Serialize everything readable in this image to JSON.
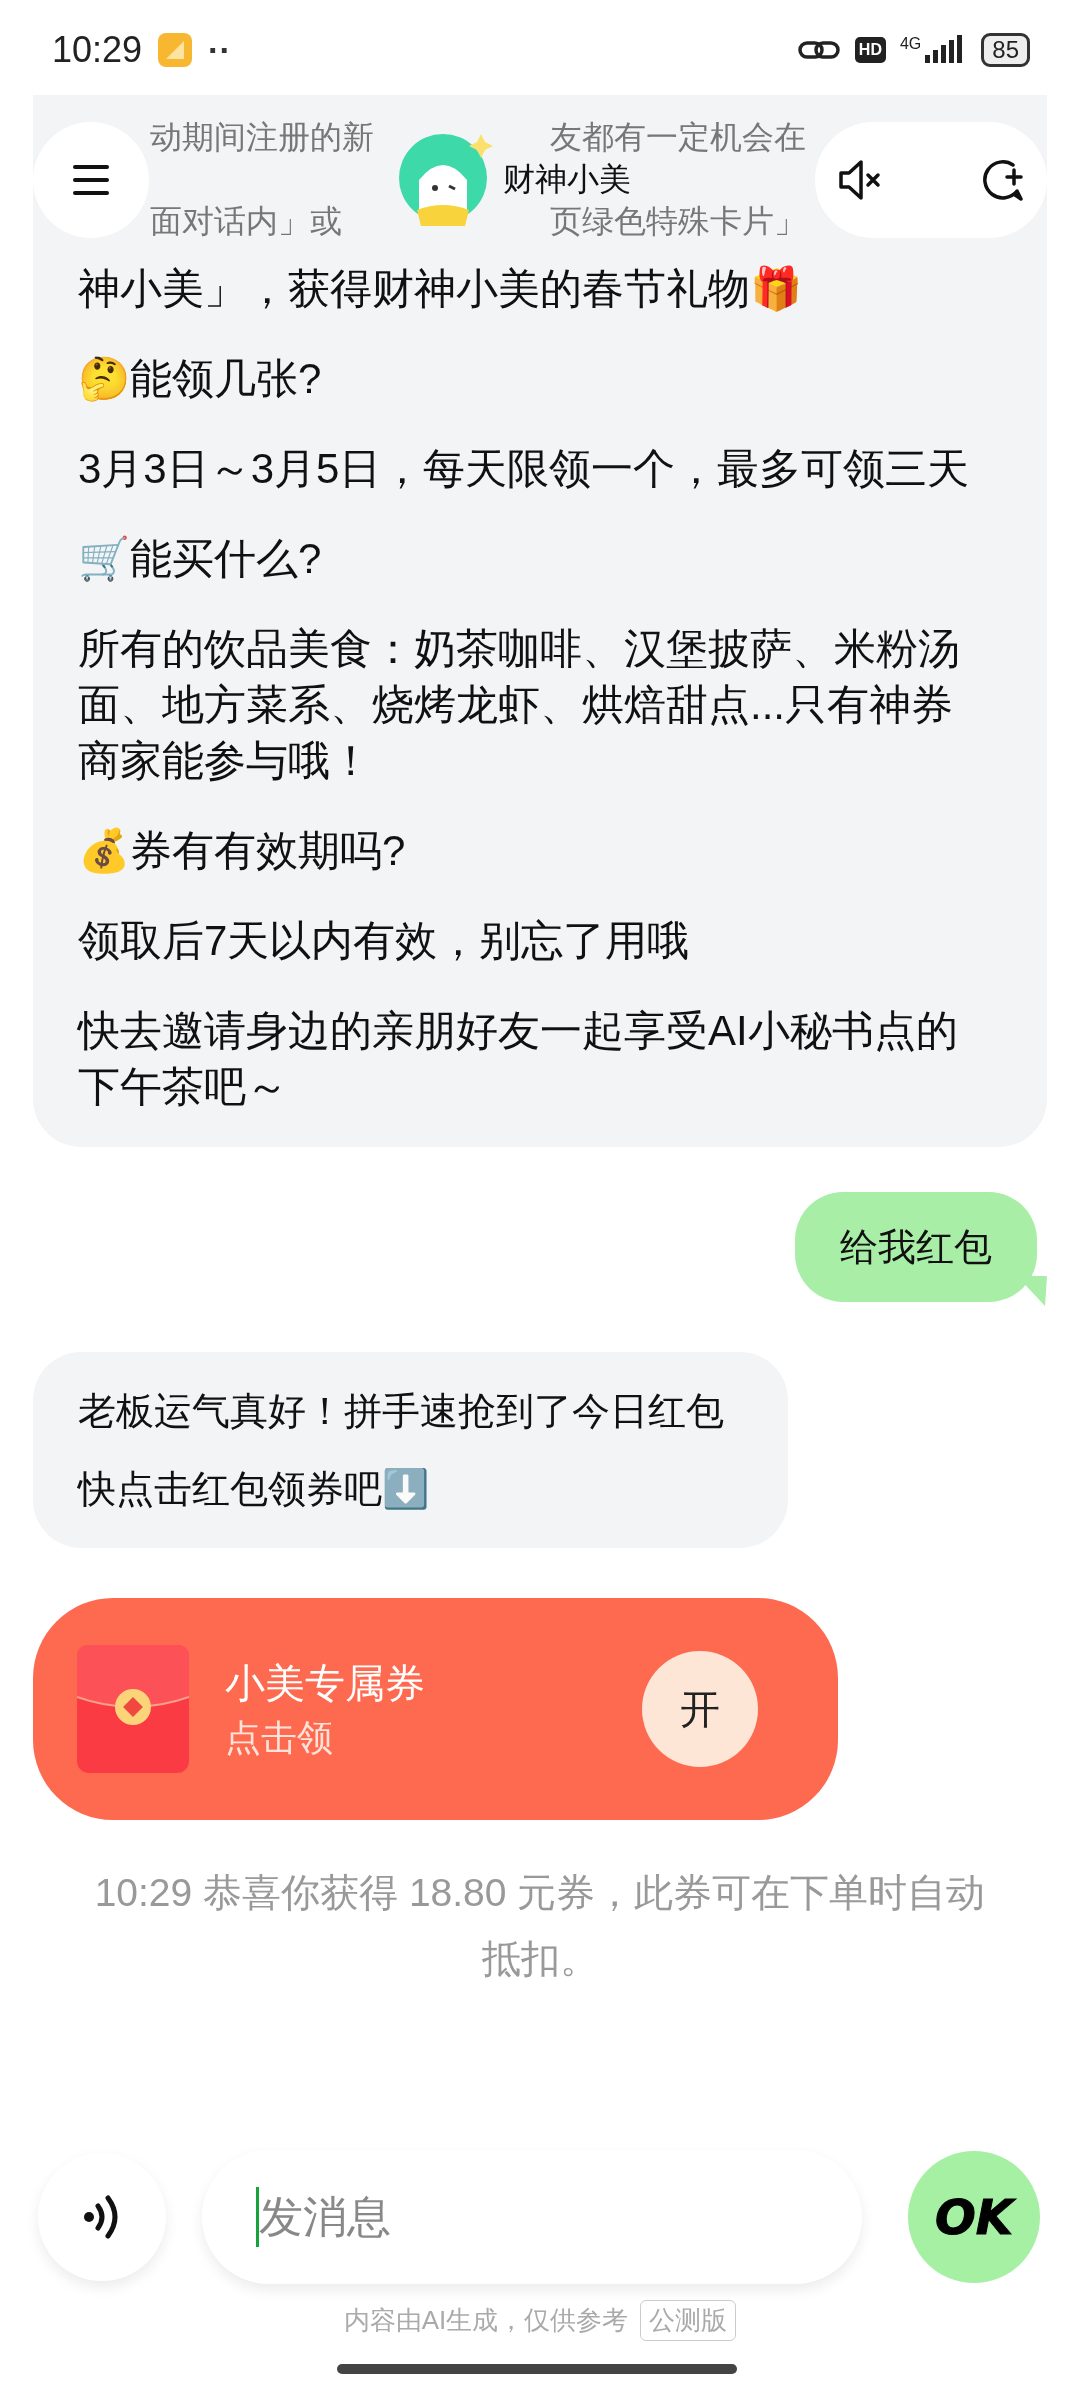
{
  "status_bar": {
    "time": "10:29",
    "dots": "··",
    "hd": "HD",
    "network": "4G",
    "battery": "85"
  },
  "header": {
    "title": "财神小美"
  },
  "messages": [
    {
      "kind": "bot",
      "covered_rows": [
        [
          "动期间注册的新",
          "友都有一定机会在"
        ],
        [
          "面对话内」或",
          "页绿色特殊卡片」"
        ]
      ],
      "paragraphs": [
        "神小美」，获得财神小美的春节礼物🎁",
        "🤔能领几张?",
        "3月3日～3月5日，每天限领一个，最多可领三天",
        "🛒能买什么?",
        "所有的饮品美食：奶茶咖啡、汉堡披萨、米粉汤面、地方菜系、烧烤龙虾、烘焙甜点...只有神券商家能参与哦！",
        "💰券有有效期吗?",
        "领取后7天以内有效，别忘了用哦",
        "快去邀请身边的亲朋好友一起享受AI小秘书点的下午茶吧～"
      ]
    },
    {
      "kind": "user",
      "paragraphs": [
        "给我红包"
      ]
    },
    {
      "kind": "bot",
      "paragraphs": [
        "老板运气真好！拼手速抢到了今日红包",
        "快点击红包领券吧⬇️"
      ]
    },
    {
      "kind": "coupon",
      "title": "小美专属券",
      "subtitle": "点击领",
      "action": "开"
    },
    {
      "kind": "system",
      "text": "10:29 恭喜你获得 18.80 元券，此券可在下单时自动抵扣。"
    }
  ],
  "composer": {
    "placeholder": "发消息",
    "send_label": "OK"
  },
  "footer": {
    "disclaimer": "内容由AI生成，仅供参考",
    "badge": "公测版"
  }
}
